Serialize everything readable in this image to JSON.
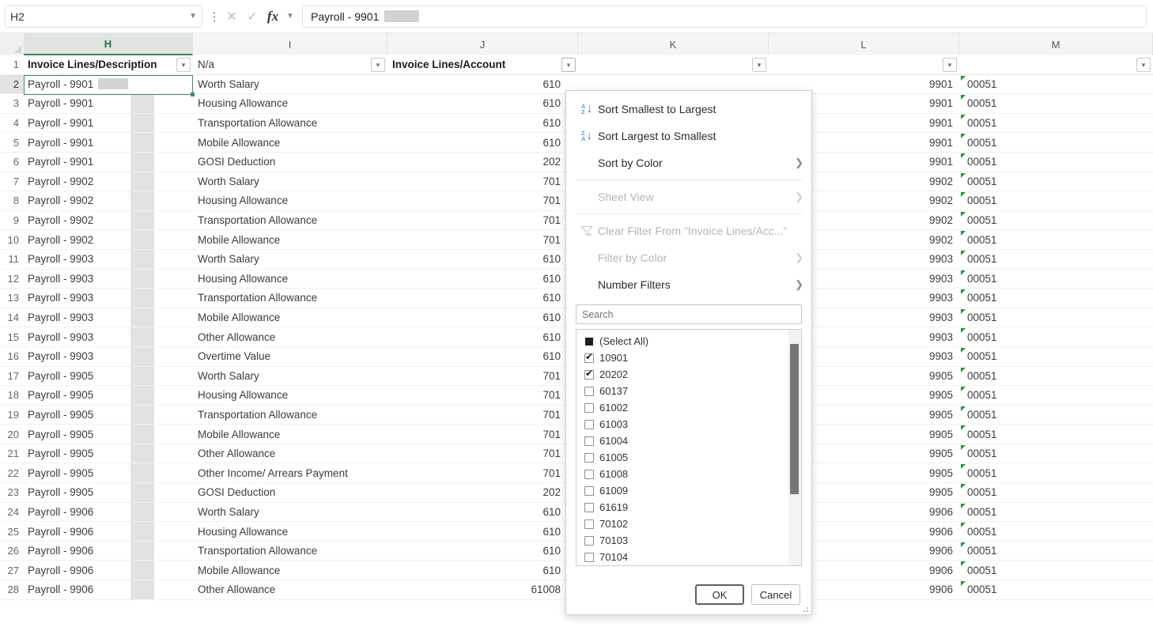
{
  "formula_bar": {
    "name_box_value": "H2",
    "formula_value": "Payroll - 9901",
    "icons": {
      "menu": "⋮",
      "cancel": "✕",
      "confirm": "✓",
      "fx": "fx",
      "chevron": "⌄"
    }
  },
  "columns": {
    "letters": [
      "H",
      "I",
      "J",
      "K",
      "L",
      "M"
    ],
    "active": "H"
  },
  "headers": {
    "h": "Invoice Lines/Description",
    "i": "N/a",
    "j": "Invoice Lines/Account",
    "k": "",
    "l": "",
    "m": ""
  },
  "rows": [
    {
      "n": "2",
      "h": "Payroll - 9901",
      "i": "Worth Salary",
      "j": "610",
      "l": "9901",
      "m": "00051"
    },
    {
      "n": "3",
      "h": "Payroll - 9901",
      "i": "Housing Allowance",
      "j": "610",
      "l": "9901",
      "m": "00051"
    },
    {
      "n": "4",
      "h": "Payroll - 9901",
      "i": "Transportation Allowance",
      "j": "610",
      "l": "9901",
      "m": "00051"
    },
    {
      "n": "5",
      "h": "Payroll - 9901",
      "i": "Mobile Allowance",
      "j": "610",
      "l": "9901",
      "m": "00051"
    },
    {
      "n": "6",
      "h": "Payroll - 9901",
      "i": "GOSI Deduction",
      "j": "202",
      "l": "9901",
      "m": "00051"
    },
    {
      "n": "7",
      "h": "Payroll - 9902",
      "i": "Worth Salary",
      "j": "701",
      "l": "9902",
      "m": "00051"
    },
    {
      "n": "8",
      "h": "Payroll - 9902",
      "i": "Housing Allowance",
      "j": "701",
      "l": "9902",
      "m": "00051"
    },
    {
      "n": "9",
      "h": "Payroll - 9902",
      "i": "Transportation Allowance",
      "j": "701",
      "l": "9902",
      "m": "00051"
    },
    {
      "n": "10",
      "h": "Payroll - 9902",
      "i": "Mobile Allowance",
      "j": "701",
      "l": "9902",
      "m": "00051"
    },
    {
      "n": "11",
      "h": "Payroll - 9903",
      "i": "Worth Salary",
      "j": "610",
      "l": "9903",
      "m": "00051"
    },
    {
      "n": "12",
      "h": "Payroll - 9903",
      "i": "Housing Allowance",
      "j": "610",
      "l": "9903",
      "m": "00051"
    },
    {
      "n": "13",
      "h": "Payroll - 9903",
      "i": "Transportation Allowance",
      "j": "610",
      "l": "9903",
      "m": "00051"
    },
    {
      "n": "14",
      "h": "Payroll - 9903",
      "i": "Mobile Allowance",
      "j": "610",
      "l": "9903",
      "m": "00051"
    },
    {
      "n": "15",
      "h": "Payroll - 9903",
      "i": "Other Allowance",
      "j": "610",
      "l": "9903",
      "m": "00051"
    },
    {
      "n": "16",
      "h": "Payroll - 9903",
      "i": "Overtime Value",
      "j": "610",
      "l": "9903",
      "m": "00051"
    },
    {
      "n": "17",
      "h": "Payroll - 9905",
      "i": "Worth Salary",
      "j": "701",
      "l": "9905",
      "m": "00051"
    },
    {
      "n": "18",
      "h": "Payroll - 9905",
      "i": "Housing Allowance",
      "j": "701",
      "l": "9905",
      "m": "00051"
    },
    {
      "n": "19",
      "h": "Payroll - 9905",
      "i": "Transportation Allowance",
      "j": "701",
      "l": "9905",
      "m": "00051"
    },
    {
      "n": "20",
      "h": "Payroll - 9905",
      "i": "Mobile Allowance",
      "j": "701",
      "l": "9905",
      "m": "00051"
    },
    {
      "n": "21",
      "h": "Payroll - 9905",
      "i": "Other Allowance",
      "j": "701",
      "l": "9905",
      "m": "00051"
    },
    {
      "n": "22",
      "h": "Payroll - 9905",
      "i": "Other Income/ Arrears Payment",
      "j": "701",
      "l": "9905",
      "m": "00051"
    },
    {
      "n": "23",
      "h": "Payroll - 9905",
      "i": "GOSI Deduction",
      "j": "202",
      "l": "9905",
      "m": "00051"
    },
    {
      "n": "24",
      "h": "Payroll - 9906",
      "i": "Worth Salary",
      "j": "610",
      "l": "9906",
      "m": "00051"
    },
    {
      "n": "25",
      "h": "Payroll - 9906",
      "i": "Housing Allowance",
      "j": "610",
      "l": "9906",
      "m": "00051"
    },
    {
      "n": "26",
      "h": "Payroll - 9906",
      "i": "Transportation Allowance",
      "j": "610",
      "l": "9906",
      "m": "00051"
    },
    {
      "n": "27",
      "h": "Payroll - 9906",
      "i": "Mobile Allowance",
      "j": "610",
      "l": "9906",
      "m": "00051"
    },
    {
      "n": "28",
      "h": "Payroll - 9906",
      "i": "Other Allowance",
      "j": "61008",
      "l": "9906",
      "m": "00051"
    }
  ],
  "filter_dropdown": {
    "menu": [
      {
        "label": "Sort Smallest to Largest",
        "icon": "sort-ascending-icon",
        "disabled": false,
        "submenu": false
      },
      {
        "label": "Sort Largest to Smallest",
        "icon": "sort-descending-icon",
        "disabled": false,
        "submenu": false
      },
      {
        "label": "Sort by Color",
        "icon": "",
        "disabled": false,
        "submenu": true
      },
      {
        "label": "Sheet View",
        "icon": "",
        "disabled": true,
        "submenu": true
      },
      {
        "label": "Clear Filter From \"Invoice Lines/Acc...\"",
        "icon": "clear-filter-icon",
        "disabled": true,
        "submenu": false
      },
      {
        "label": "Filter by Color",
        "icon": "",
        "disabled": true,
        "submenu": true
      },
      {
        "label": "Number Filters",
        "icon": "",
        "disabled": false,
        "submenu": true
      }
    ],
    "search_placeholder": "Search",
    "search_value": "",
    "items": [
      {
        "label": "(Select All)",
        "state": "indeterminate"
      },
      {
        "label": "10901",
        "state": "checked"
      },
      {
        "label": "20202",
        "state": "checked"
      },
      {
        "label": "60137",
        "state": "unchecked"
      },
      {
        "label": "61002",
        "state": "unchecked"
      },
      {
        "label": "61003",
        "state": "unchecked"
      },
      {
        "label": "61004",
        "state": "unchecked"
      },
      {
        "label": "61005",
        "state": "unchecked"
      },
      {
        "label": "61008",
        "state": "unchecked"
      },
      {
        "label": "61009",
        "state": "unchecked"
      },
      {
        "label": "61619",
        "state": "unchecked"
      },
      {
        "label": "70102",
        "state": "unchecked"
      },
      {
        "label": "70103",
        "state": "unchecked"
      },
      {
        "label": "70104",
        "state": "unchecked"
      }
    ],
    "ok_label": "OK",
    "cancel_label": "Cancel"
  },
  "colors": {
    "selection_green": "#3f8f62",
    "sort_icon_blue": "#5b9bd5",
    "error_triangle_green": "#2f8b44",
    "scrollbar_thumb": "#767676"
  }
}
